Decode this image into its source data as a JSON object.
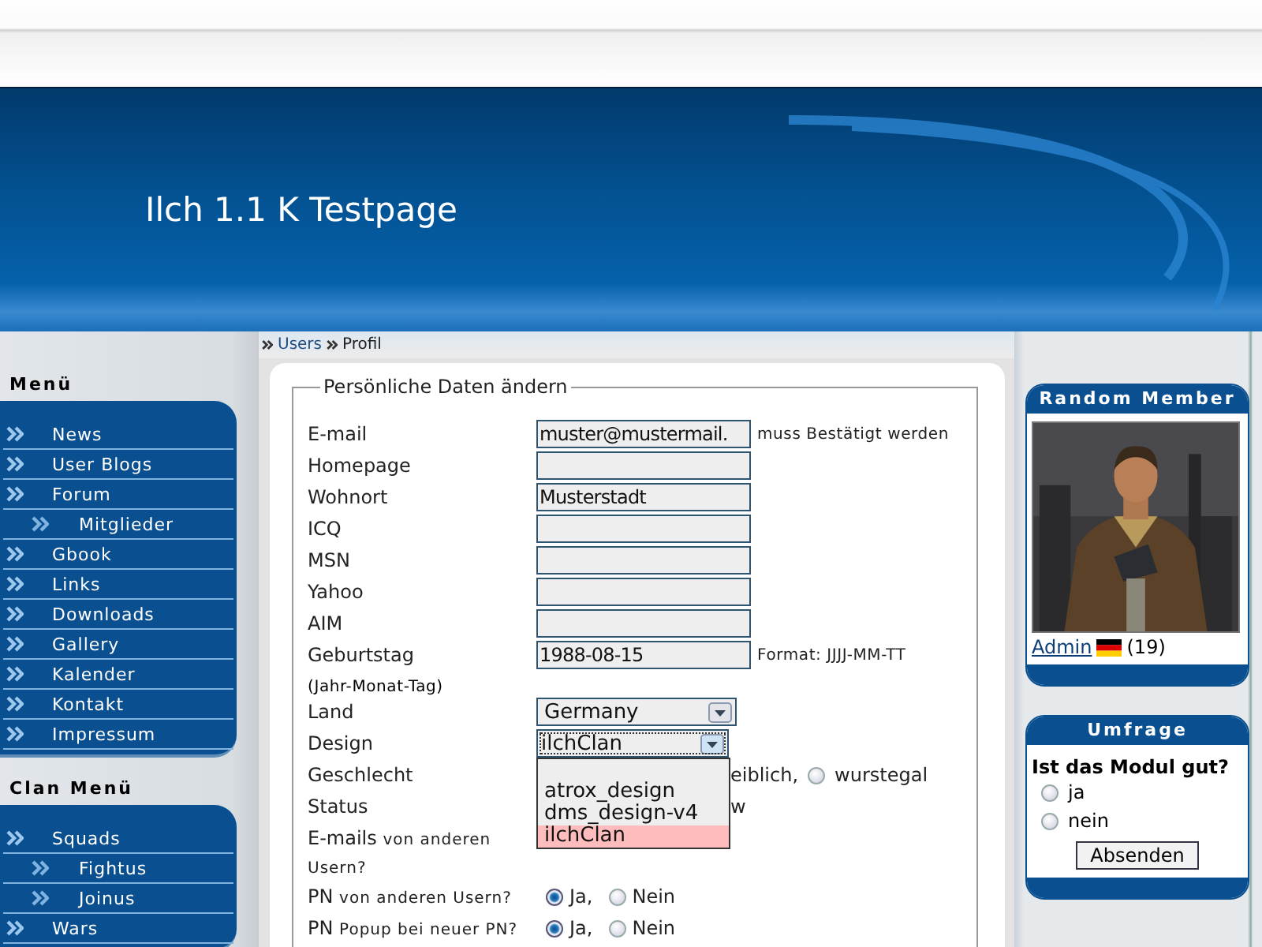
{
  "header": {
    "title": "Ilch 1.1 K Testpage"
  },
  "menus": [
    {
      "title": "Menü",
      "items": [
        {
          "label": "News"
        },
        {
          "label": "User Blogs"
        },
        {
          "label": "Forum",
          "children": [
            {
              "label": "Mitglieder"
            }
          ]
        },
        {
          "label": "Gbook"
        },
        {
          "label": "Links"
        },
        {
          "label": "Downloads"
        },
        {
          "label": "Gallery"
        },
        {
          "label": "Kalender"
        },
        {
          "label": "Kontakt"
        },
        {
          "label": "Impressum"
        }
      ]
    },
    {
      "title": "Clan Menü",
      "items": [
        {
          "label": "Squads",
          "children": [
            {
              "label": "Fightus"
            },
            {
              "label": "Joinus"
            }
          ]
        },
        {
          "label": "Wars"
        }
      ]
    }
  ],
  "breadcrumb": [
    {
      "label": "Users",
      "kind": "link"
    },
    {
      "label": "Profil",
      "kind": "text"
    }
  ],
  "form": {
    "legend": "Persönliche Daten ändern",
    "rows": [
      {
        "label": "E-mail",
        "control": {
          "kind": "input",
          "value": "muster@mustermail."
        },
        "note": "muss Bestätigt werden"
      },
      {
        "label": "Homepage",
        "control": {
          "kind": "input"
        }
      },
      {
        "label": "Wohnort",
        "control": {
          "kind": "input",
          "value": "Musterstadt"
        }
      },
      {
        "label": "ICQ",
        "control": {
          "kind": "input"
        }
      },
      {
        "label": "MSN",
        "control": {
          "kind": "input"
        }
      },
      {
        "label": "Yahoo",
        "control": {
          "kind": "input"
        }
      },
      {
        "label": "AIM",
        "control": {
          "kind": "input"
        }
      },
      {
        "label": "Geburtstag",
        "sublabel": "(Jahr-Monat-Tag)",
        "control": {
          "kind": "input",
          "value": "1988-08-15"
        },
        "note": "Format: JJJJ-MM-TT"
      },
      {
        "label": "Land",
        "control": {
          "kind": "select",
          "value": "Germany",
          "expanded": false
        }
      },
      {
        "label": "Design",
        "control": {
          "kind": "select",
          "value": "ilchClan",
          "expanded": true,
          "options": [
            {
              "label": "atrox_design",
              "selected": false
            },
            {
              "label": "dms_design-v4",
              "selected": false
            },
            {
              "label": "ilchClan",
              "selected": true
            }
          ]
        }
      },
      {
        "label": "Geschlecht",
        "control": {
          "kind": "covered",
          "items": [
            {
              "kind": "text",
              "text": "eiblich,"
            },
            {
              "kind": "radio",
              "label": "wurstegal",
              "checked": false
            }
          ]
        }
      },
      {
        "label": "Status",
        "control": {
          "kind": "covered",
          "items": [
            {
              "kind": "text",
              "text": "w"
            }
          ]
        }
      },
      {
        "label": "E-mails",
        "small": "von anderen Usern?"
      },
      {
        "label": "PN",
        "small": "von anderen Usern?",
        "control": {
          "kind": "radios",
          "items": [
            {
              "label": "Ja,",
              "checked": true
            },
            {
              "label": "Nein",
              "checked": false
            }
          ]
        }
      },
      {
        "label": "PN",
        "small": "Popup bei neuer PN?",
        "control": {
          "kind": "radios",
          "items": [
            {
              "label": "Ja,",
              "checked": true
            },
            {
              "label": "Nein",
              "checked": false
            }
          ]
        }
      }
    ]
  },
  "random_member": {
    "title": "Random Member",
    "name": "Admin",
    "age": "(19)"
  },
  "poll": {
    "title": "Umfrage",
    "question": "Ist das Modul gut?",
    "options": [
      {
        "label": "ja",
        "checked": false
      },
      {
        "label": "nein",
        "checked": false
      }
    ],
    "button": "Absenden"
  }
}
